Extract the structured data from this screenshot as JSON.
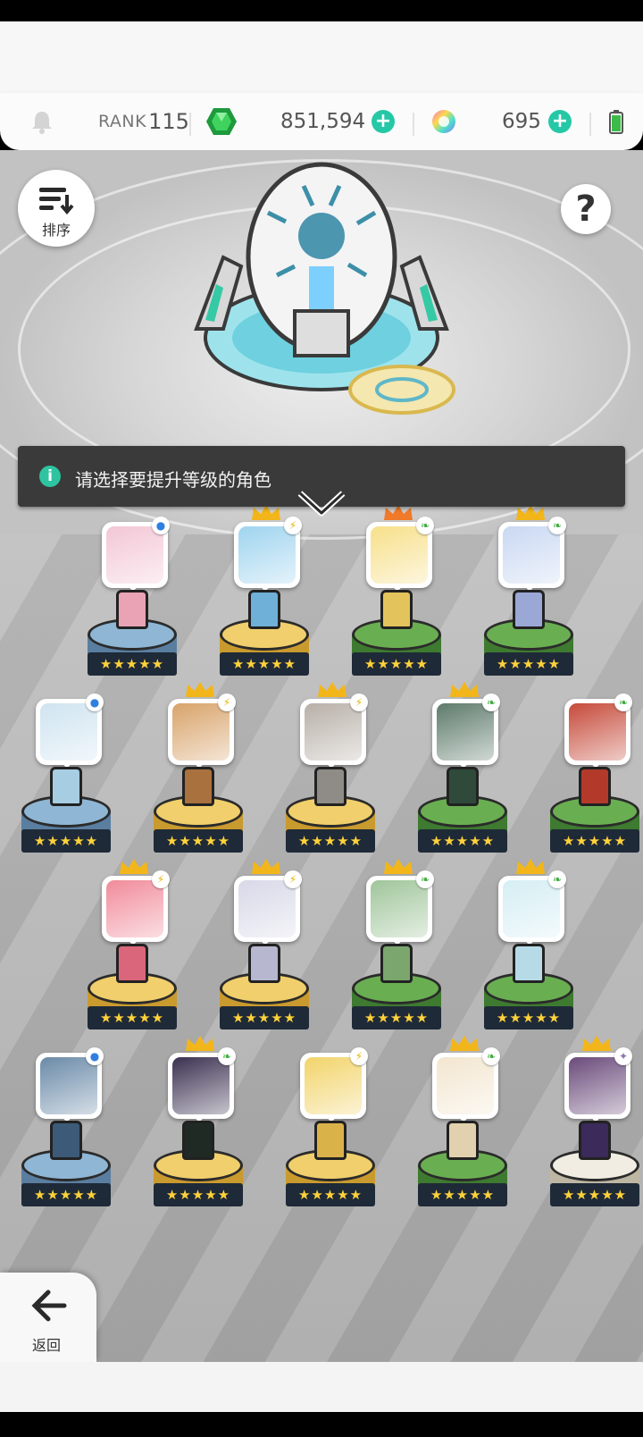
{
  "header": {
    "rank_label": "RANK",
    "rank_value": "115",
    "gems": "851,594",
    "crystals": "695",
    "icons": [
      "bell-icon",
      "green-gem-icon",
      "rainbow-orb-icon",
      "battery-icon"
    ]
  },
  "sort": {
    "label": "排序",
    "icon": "sort-icon"
  },
  "help": {
    "label": "?"
  },
  "notice": {
    "text": "请选择要提升等级的角色"
  },
  "back": {
    "label": "返回",
    "icon": "arrow-left-icon"
  },
  "colors": {
    "accent_teal": "#25c8a6",
    "pedestal_blue": "#7fa8c8",
    "pedestal_gold": "#e7c25a",
    "pedestal_green": "#5f9f4a",
    "pedestal_white": "#e8e4d8"
  },
  "heroes": [
    {
      "element": "water",
      "crown": "none",
      "pedestal": "blue"
    },
    {
      "element": "light",
      "crown": "gold",
      "pedestal": "gold"
    },
    {
      "element": "nature",
      "crown": "orange",
      "pedestal": "green"
    },
    {
      "element": "nature",
      "crown": "gold",
      "pedestal": "green"
    },
    {
      "element": "water",
      "crown": "none",
      "pedestal": "blue"
    },
    {
      "element": "light",
      "crown": "gold",
      "pedestal": "gold"
    },
    {
      "element": "light",
      "crown": "gold",
      "pedestal": "gold"
    },
    {
      "element": "nature",
      "crown": "gold",
      "pedestal": "green"
    },
    {
      "element": "nature",
      "crown": "none",
      "pedestal": "green"
    },
    {
      "element": "light",
      "crown": "gold",
      "pedestal": "gold"
    },
    {
      "element": "light",
      "crown": "gold",
      "pedestal": "gold"
    },
    {
      "element": "nature",
      "crown": "gold",
      "pedestal": "green"
    },
    {
      "element": "nature",
      "crown": "gold",
      "pedestal": "green"
    },
    {
      "element": "water",
      "crown": "none",
      "pedestal": "blue"
    },
    {
      "element": "nature",
      "crown": "gold",
      "pedestal": "gold"
    },
    {
      "element": "light",
      "crown": "none",
      "pedestal": "gold"
    },
    {
      "element": "nature",
      "crown": "gold",
      "pedestal": "green"
    },
    {
      "element": "dark",
      "crown": "gold",
      "pedestal": "white"
    }
  ],
  "stars_per_hero": 5
}
